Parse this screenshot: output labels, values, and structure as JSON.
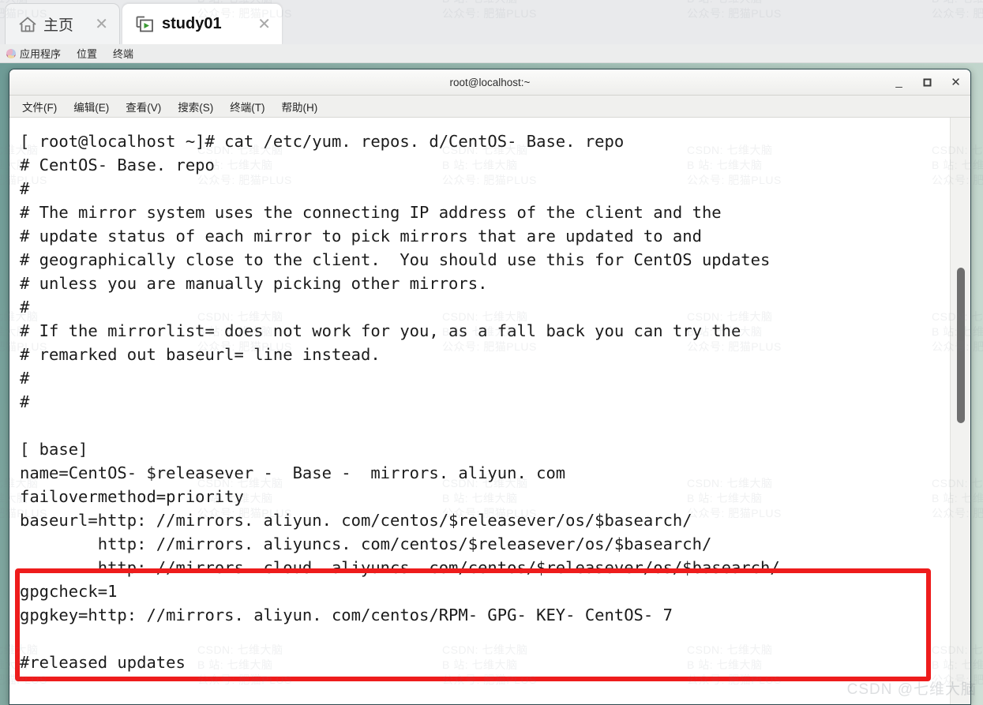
{
  "tabs": [
    {
      "label": "主页",
      "icon": "home-icon",
      "close": "✕",
      "active": false
    },
    {
      "label": "study01",
      "icon": "terminal-session-icon",
      "close": "✕",
      "active": true
    }
  ],
  "gnome_panel": {
    "logo": "fedora-logo-icon",
    "items": [
      "应用程序",
      "位置",
      "终端"
    ]
  },
  "window": {
    "title": "root@localhost:~",
    "buttons": {
      "minimize": "_",
      "maximize": "❐",
      "close": "✕"
    },
    "menu": [
      "文件(F)",
      "编辑(E)",
      "查看(V)",
      "搜索(S)",
      "终端(T)",
      "帮助(H)"
    ]
  },
  "terminal": {
    "lines": [
      "[ root@localhost ~]# cat /etc/yum. repos. d/CentOS- Base. repo",
      "# CentOS- Base. repo",
      "#",
      "# The mirror system uses the connecting IP address of the client and the",
      "# update status of each mirror to pick mirrors that are updated to and",
      "# geographically close to the client.  You should use this for CentOS updates",
      "# unless you are manually picking other mirrors.",
      "#",
      "# If the mirrorlist= does not work for you, as a fall back you can try the",
      "# remarked out baseurl= line instead.",
      "#",
      "#",
      "",
      "[ base]",
      "name=CentOS- $releasever -  Base -  mirrors. aliyun. com",
      "failovermethod=priority",
      "baseurl=http: //mirrors. aliyun. com/centos/$releasever/os/$basearch/",
      "        http: //mirrors. aliyuncs. com/centos/$releasever/os/$basearch/",
      "        http: //mirrors. cloud. aliyuncs. com/centos/$releasever/os/$basearch/",
      "gpgcheck=1",
      "gpgkey=http: //mirrors. aliyun. com/centos/RPM- GPG- KEY- CentOS- 7",
      "",
      "#released updates"
    ]
  },
  "annotation": {
    "color": "#ee1c1c",
    "highlights_lines": [
      "baseurl=http: //mirrors. aliyun. com/centos/$releasever/os/$basearch/",
      "        http: //mirrors. aliyuncs. com/centos/$releasever/os/$basearch/",
      "        http: //mirrors. cloud. aliyuncs. com/centos/$releasever/os/$basearch/",
      "gpgcheck=1"
    ]
  },
  "watermark": {
    "line1": "CSDN: 七维大脑",
    "line2": "B  站: 七维大脑",
    "line3": "公众号: 肥猫PLUS",
    "corner": "CSDN @七维大脑"
  },
  "colors": {
    "desktop_teal": "#8fb2a9",
    "annotation_red": "#ee1c1c",
    "terminal_bg": "#ffffff",
    "terminal_fg": "#1b1b1b",
    "tab_active_bg": "#ffffff"
  }
}
